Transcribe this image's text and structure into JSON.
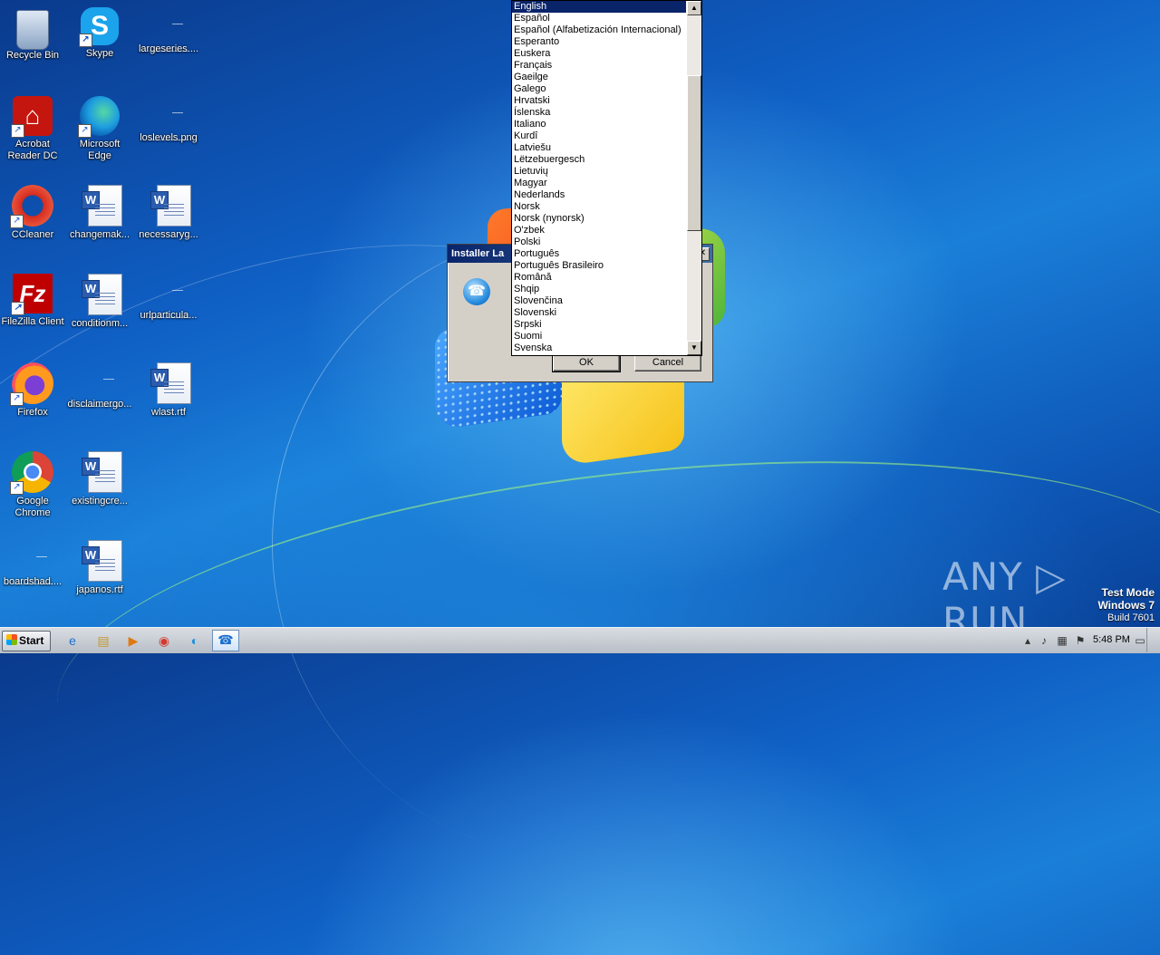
{
  "desktop": {
    "icons": [
      {
        "label": "Recycle Bin",
        "icon": "recycle-bin-icon",
        "shortcut": false
      },
      {
        "label": "Skype",
        "icon": "skype-icon",
        "shortcut": true
      },
      {
        "label": "largeseries....",
        "icon": "file-icon",
        "shortcut": false
      },
      {
        "label": "Acrobat Reader DC",
        "icon": "acrobat-icon",
        "shortcut": true
      },
      {
        "label": "Microsoft Edge",
        "icon": "edge-icon",
        "shortcut": true
      },
      {
        "label": "loslevels.png",
        "icon": "file-icon",
        "shortcut": false
      },
      {
        "label": "CCleaner",
        "icon": "ccleaner-icon",
        "shortcut": true
      },
      {
        "label": "changemak...",
        "icon": "word-doc-icon",
        "shortcut": false
      },
      {
        "label": "necessaryg...",
        "icon": "word-doc-icon",
        "shortcut": false
      },
      {
        "label": "FileZilla Client",
        "icon": "filezilla-icon",
        "shortcut": true
      },
      {
        "label": "conditionm...",
        "icon": "word-doc-icon",
        "shortcut": false
      },
      {
        "label": "urlparticula...",
        "icon": "file-icon",
        "shortcut": false
      },
      {
        "label": "Firefox",
        "icon": "firefox-icon",
        "shortcut": true
      },
      {
        "label": "disclaimergo...",
        "icon": "file-icon",
        "shortcut": false
      },
      {
        "label": "wlast.rtf",
        "icon": "word-doc-icon",
        "shortcut": false
      },
      {
        "label": "Google Chrome",
        "icon": "chrome-icon",
        "shortcut": true
      },
      {
        "label": "existingcre...",
        "icon": "word-doc-icon",
        "shortcut": false
      },
      {
        "label": "boardshad....",
        "icon": "file-icon",
        "shortcut": false
      },
      {
        "label": "japanos.rtf",
        "icon": "word-doc-icon",
        "shortcut": false
      }
    ]
  },
  "dialog": {
    "title": "Installer La",
    "close_glyph": "✕",
    "ok_label": "OK",
    "cancel_label": "Cancel"
  },
  "language_list": {
    "selected": "English",
    "items": [
      "English",
      "Español",
      "Español (Alfabetización Internacional)",
      "Esperanto",
      "Euskera",
      "Français",
      "Gaeilge",
      "Galego",
      "Hrvatski",
      "Íslenska",
      "Italiano",
      "Kurdî",
      "Latviešu",
      "Lëtzebuergesch",
      "Lietuvių",
      "Magyar",
      "Nederlands",
      "Norsk",
      "Norsk (nynorsk)",
      "O'zbek",
      "Polski",
      "Português",
      "Português Brasileiro",
      "Română",
      "Shqip",
      "Slovenčina",
      "Slovenski",
      "Srpski",
      "Suomi",
      "Svenska"
    ]
  },
  "watermark": {
    "brand": "ANY ▷ RUN",
    "mode": "Test Mode",
    "os": "Windows 7",
    "build": "Build 7601"
  },
  "taskbar": {
    "start_label": "Start",
    "clock": "5:48 PM",
    "pinned": [
      {
        "name": "ie-icon",
        "glyph": "e"
      },
      {
        "name": "explorer-icon",
        "glyph": "▤"
      },
      {
        "name": "media-player-icon",
        "glyph": "▶"
      },
      {
        "name": "chrome-icon",
        "glyph": "◉"
      },
      {
        "name": "edge-icon",
        "glyph": "◐"
      },
      {
        "name": "installer-icon",
        "glyph": "☎"
      }
    ]
  },
  "colors": {
    "selection": "#0a246a",
    "dialog_face": "#d4d0c8"
  }
}
